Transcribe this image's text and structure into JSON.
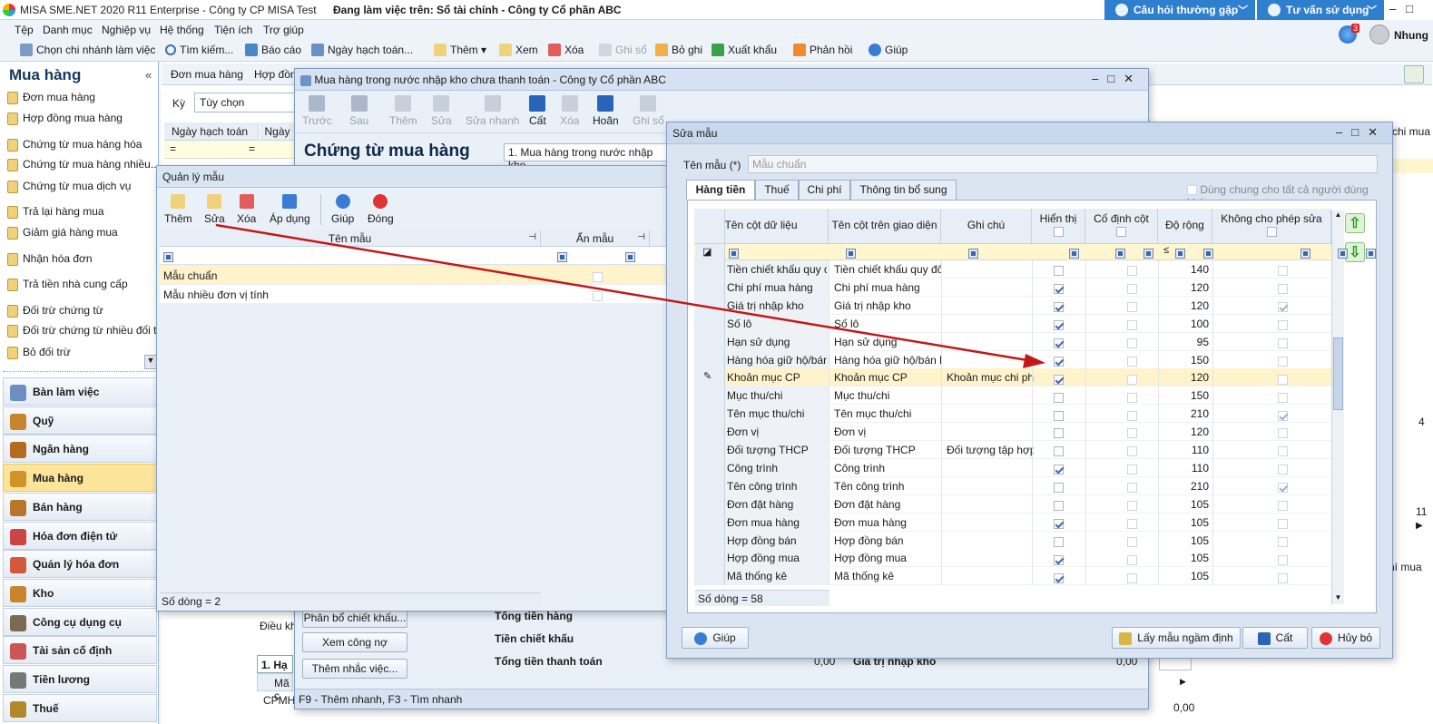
{
  "app": {
    "title": "MISA SME.NET 2020 R11 Enterprise - Công ty CP MISA Test",
    "working_on": "Đang làm việc trên: Sổ tài chính - Công ty Cổ phần ABC",
    "faq": "Câu hỏi thường gặp",
    "consult": "Tư vấn sử dụng",
    "user": "Nhung",
    "notif_count": "3"
  },
  "menu": [
    "Tệp",
    "Danh mục",
    "Nghiệp vụ",
    "Hệ thống",
    "Tiện ích",
    "Trợ giúp"
  ],
  "toolbar": {
    "branch": "Chọn chi nhánh làm việc",
    "search": "Tìm kiếm...",
    "report": "Báo cáo",
    "post_date": "Ngày hạch toán...",
    "add": "Thêm",
    "view": "Xem",
    "delete": "Xóa",
    "post": "Ghi sổ",
    "unpost": "Bỏ ghi",
    "export": "Xuất khẩu",
    "feedback": "Phản hồi",
    "help": "Giúp"
  },
  "nav": {
    "title": "Mua hàng",
    "links": [
      "Đơn mua hàng",
      "Hợp đồng mua hàng",
      "Chứng từ mua hàng hóa",
      "Chứng từ mua hàng nhiều...",
      "Chứng từ mua dịch vụ",
      "Trả lại hàng mua",
      "Giảm giá hàng mua",
      "Nhận hóa đơn",
      "Trả tiền nhà cung cấp",
      "Đối trừ chứng từ",
      "Đối trừ chứng từ nhiều đối t...",
      "Bỏ đối trừ"
    ],
    "modules": [
      "Bàn làm việc",
      "Quỹ",
      "Ngân hàng",
      "Mua hàng",
      "Bán hàng",
      "Hóa đơn điện tử",
      "Quản lý hóa đơn",
      "Kho",
      "Công cụ dụng cụ",
      "Tài sản cố định",
      "Tiền lương",
      "Thuế"
    ]
  },
  "bg": {
    "tab1": "Đơn mua hàng",
    "tab2": "Hợp đồng",
    "period_label": "Kỳ",
    "period_value": "Tùy chọn",
    "col_date": "Ngày hạch toán",
    "col_ngay": "Ngày",
    "dieu_kh": "Điều kh",
    "ma": "Mã c",
    "cpmh": "CPMH",
    "zero": "0,00",
    "right_11": "11",
    "right_4": "4",
    "right_chi_mua1": "chi mua",
    "right_chi_mua2": "hí mua"
  },
  "doc_window": {
    "title": "Mua hàng trong nước nhập kho chưa thanh toán - Công ty Cổ phần ABC",
    "tools": [
      "Trước",
      "Sau",
      "Thêm",
      "Sửa",
      "Sửa nhanh",
      "Cất",
      "Xóa",
      "Hoãn",
      "Ghi sổ"
    ],
    "heading": "Chứng từ mua hàng",
    "type_value": "1. Mua hàng trong nước nhập kho",
    "btn_discount": "Phân bổ chiết khấu...",
    "btn_debt": "Xem công nợ",
    "btn_remind": "Thêm nhắc việc...",
    "total_goods": "Tổng tiền hàng",
    "discount": "Tiền chiết khấu",
    "total_pay": "Tổng tiền thanh toán",
    "inv_value_label": "Giá trị nhập kho",
    "zero": "0,00",
    "tab_ha": "1. Hạ",
    "status": "F9 - Thêm nhanh, F3 - Tìm nhanh"
  },
  "template_manager": {
    "title": "Quản lý mẫu",
    "tools": [
      "Thêm",
      "Sửa",
      "Xóa",
      "Áp dụng",
      "Giúp",
      "Đóng"
    ],
    "col_name": "Tên mẫu",
    "col_hidden": "Ẩn mẫu",
    "rows": [
      {
        "name": "Mẫu chuẩn",
        "hidden": false
      },
      {
        "name": "Mẫu nhiều đơn vị tính",
        "hidden": false
      }
    ],
    "row_count": "Số dòng = 2"
  },
  "edit_template": {
    "title": "Sửa mẫu",
    "name_label": "Tên mẫu (*)",
    "name_value": "Mẫu chuẩn",
    "tabs": [
      "Hàng tiền",
      "Thuế",
      "Chi phí",
      "Thông tin bổ sung"
    ],
    "share_label": "Dùng chung cho tất cả người dùng khác",
    "columns": [
      "Tên cột dữ liệu",
      "Tên cột trên giao diện",
      "Ghi chú",
      "Hiển thị",
      "Cố định cột",
      "Độ rộng",
      "Không cho phép sửa"
    ],
    "rows": [
      {
        "data": "Tiền chiết khấu quy đ",
        "ui": "Tiền chiết khấu quy đổi",
        "note": "",
        "show": false,
        "fixed": false,
        "width": "140",
        "locked": false
      },
      {
        "data": "Chi phí mua hàng",
        "ui": "Chi phí mua hàng",
        "note": "",
        "show": true,
        "fixed": false,
        "width": "120",
        "locked": false
      },
      {
        "data": "Giá trị nhập kho",
        "ui": "Giá trị nhập kho",
        "note": "",
        "show": true,
        "fixed": false,
        "width": "120",
        "locked": true
      },
      {
        "data": "Số lô",
        "ui": "Số lô",
        "note": "",
        "show": true,
        "fixed": false,
        "width": "100",
        "locked": false
      },
      {
        "data": "Hạn sử dụng",
        "ui": "Hạn sử dụng",
        "note": "",
        "show": true,
        "fixed": false,
        "width": "95",
        "locked": false
      },
      {
        "data": "Hàng hóa giữ hộ/bán",
        "ui": "Hàng hóa giữ hộ/bán h",
        "note": "",
        "show": true,
        "fixed": false,
        "width": "150",
        "locked": false
      },
      {
        "data": "Khoản mục CP",
        "ui": "Khoản mục CP",
        "note": "Khoản mục chi ph",
        "show": true,
        "fixed": false,
        "width": "120",
        "locked": false
      },
      {
        "data": "Mục thu/chi",
        "ui": "Mục thu/chi",
        "note": "",
        "show": false,
        "fixed": false,
        "width": "150",
        "locked": false
      },
      {
        "data": "Tên mục thu/chi",
        "ui": "Tên mục thu/chi",
        "note": "",
        "show": false,
        "fixed": false,
        "width": "210",
        "locked": true
      },
      {
        "data": "Đơn vị",
        "ui": "Đơn vị",
        "note": "",
        "show": false,
        "fixed": false,
        "width": "120",
        "locked": false
      },
      {
        "data": "Đối tượng THCP",
        "ui": "Đối tượng THCP",
        "note": "Đối tượng tập hợp",
        "show": false,
        "fixed": false,
        "width": "110",
        "locked": false
      },
      {
        "data": "Công trình",
        "ui": "Công trình",
        "note": "",
        "show": true,
        "fixed": false,
        "width": "110",
        "locked": false
      },
      {
        "data": "Tên công trình",
        "ui": "Tên công trình",
        "note": "",
        "show": false,
        "fixed": false,
        "width": "210",
        "locked": true
      },
      {
        "data": "Đơn đặt hàng",
        "ui": "Đơn đặt hàng",
        "note": "",
        "show": false,
        "fixed": false,
        "width": "105",
        "locked": false
      },
      {
        "data": "Đơn mua hàng",
        "ui": "Đơn mua hàng",
        "note": "",
        "show": true,
        "fixed": false,
        "width": "105",
        "locked": false
      },
      {
        "data": "Hợp đồng bán",
        "ui": "Hợp đồng bán",
        "note": "",
        "show": false,
        "fixed": false,
        "width": "105",
        "locked": false
      },
      {
        "data": "Hợp đồng mua",
        "ui": "Hợp đồng mua",
        "note": "",
        "show": true,
        "fixed": false,
        "width": "105",
        "locked": false
      },
      {
        "data": "Mã thống kê",
        "ui": "Mã thống kê",
        "note": "",
        "show": true,
        "fixed": false,
        "width": "105",
        "locked": false
      }
    ],
    "filter_le": "≤",
    "row_count": "Số dòng = 58",
    "help": "Giúp",
    "default_template": "Lấy mẫu ngầm định",
    "save": "Cất",
    "cancel": "Hủy bỏ"
  }
}
